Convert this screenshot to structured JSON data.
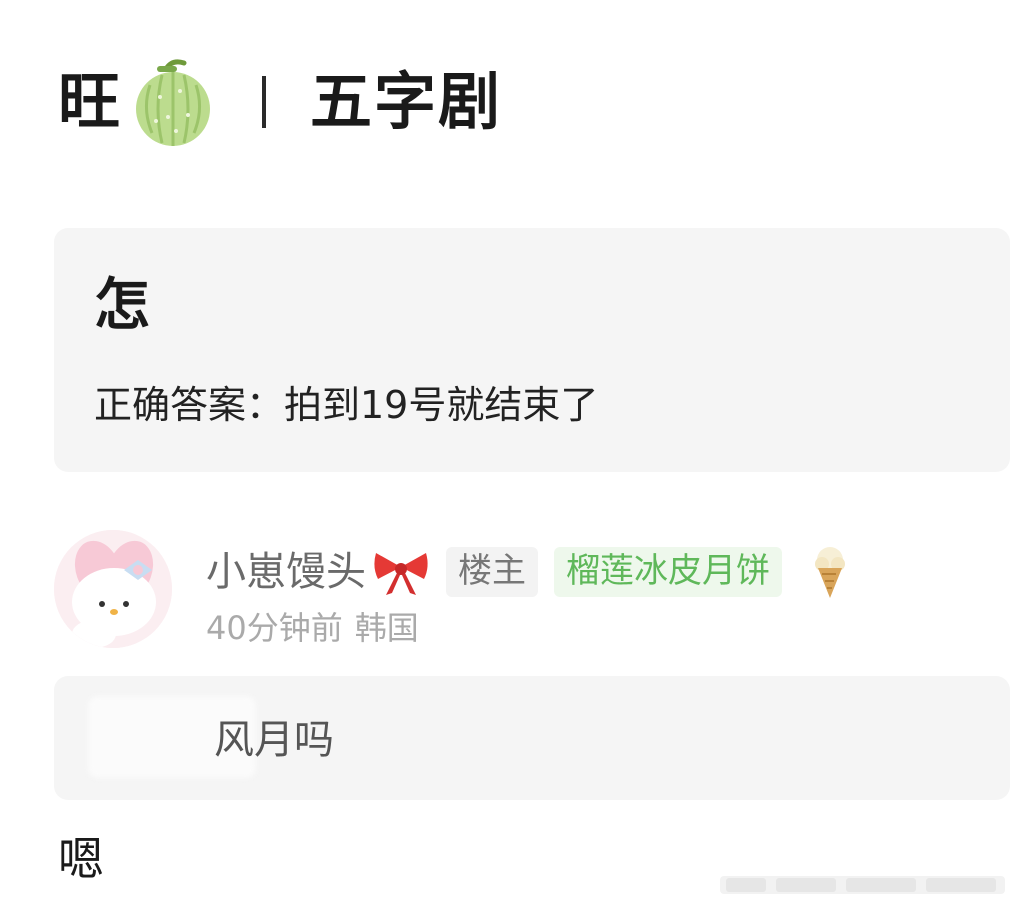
{
  "title": {
    "prefix": "旺",
    "suffix": "五字剧",
    "icon": "melon-icon"
  },
  "post": {
    "heading": "怎",
    "body": "正确答案：拍到19号就结束了"
  },
  "comment": {
    "username": "小崽馒头",
    "username_icon": "bow-icon",
    "op_badge": "楼主",
    "fan_badge": "榴莲冰皮月饼",
    "badge_icon": "ice-cream-cone-icon",
    "time": "40分钟前",
    "location": "韩国",
    "reply": "风月吗"
  },
  "footer_text": "嗯",
  "colors": {
    "background": "#ffffff",
    "card": "#f5f5f5",
    "fan_badge_text": "#5fb85a",
    "meta_text": "#aaaaaa",
    "melon": "#b8d98a"
  }
}
